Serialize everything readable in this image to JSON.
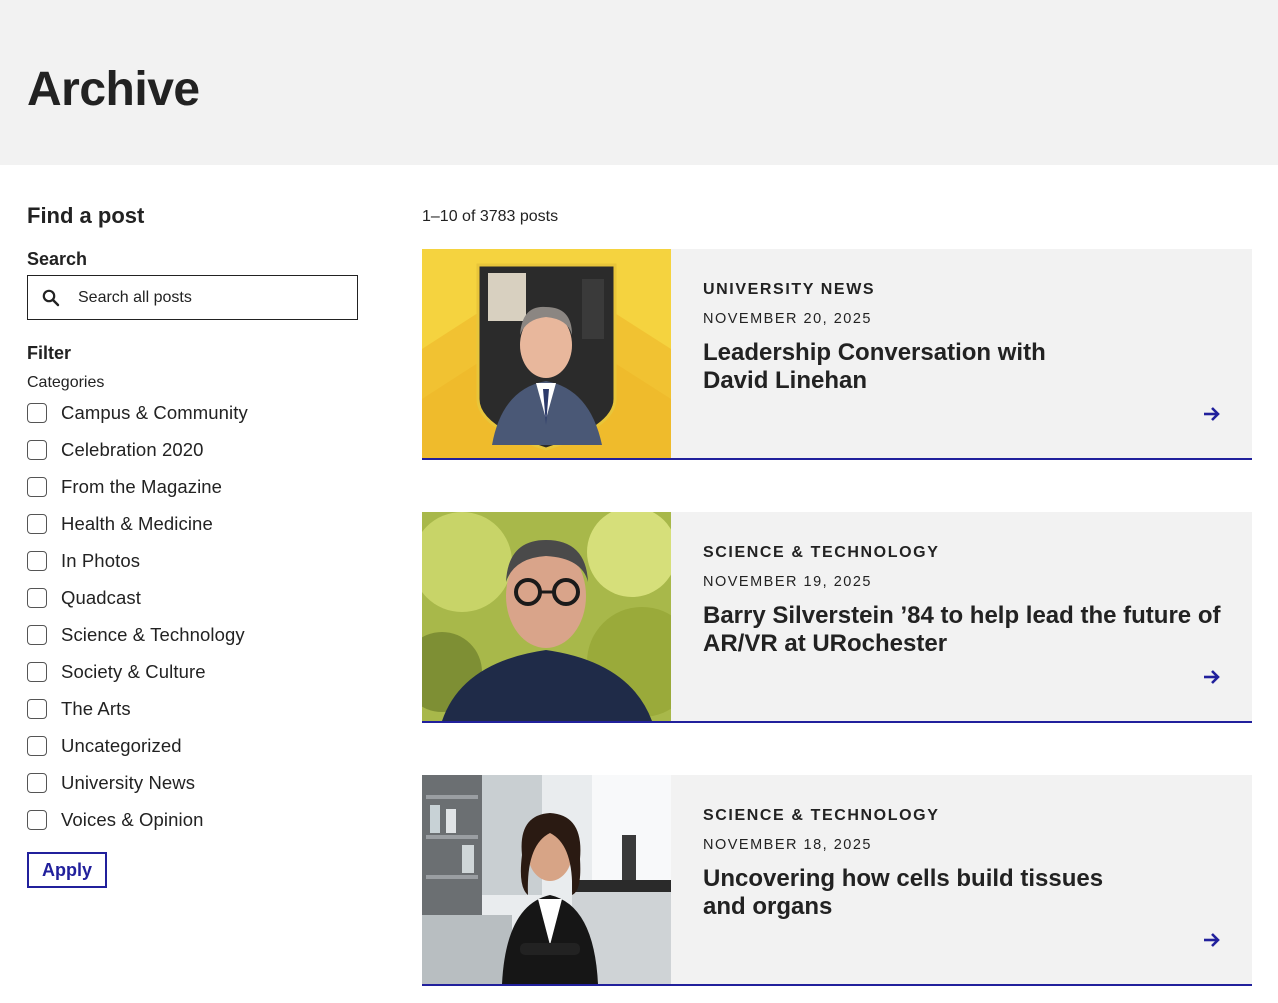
{
  "header": {
    "title": "Archive"
  },
  "sidebar": {
    "find_title": "Find a post",
    "search_label": "Search",
    "search_placeholder": "Search all posts",
    "filter_label": "Filter",
    "categories_label": "Categories",
    "categories": [
      {
        "label": "Campus & Community",
        "checked": false
      },
      {
        "label": "Celebration 2020",
        "checked": false
      },
      {
        "label": "From the Magazine",
        "checked": false
      },
      {
        "label": "Health & Medicine",
        "checked": false
      },
      {
        "label": "In Photos",
        "checked": false
      },
      {
        "label": "Quadcast",
        "checked": false
      },
      {
        "label": "Science & Technology",
        "checked": false
      },
      {
        "label": "Society & Culture",
        "checked": false
      },
      {
        "label": "The Arts",
        "checked": false
      },
      {
        "label": "Uncategorized",
        "checked": false
      },
      {
        "label": "University News",
        "checked": false
      },
      {
        "label": "Voices & Opinion",
        "checked": false
      }
    ],
    "apply_label": "Apply"
  },
  "results": {
    "count_text": "1–10 of 3783 posts"
  },
  "posts": [
    {
      "category": "UNIVERSITY NEWS",
      "date": "NOVEMBER 20, 2025",
      "title": "Leadership Conversation with David Linehan",
      "image_icon": "portrait-shield-yellow",
      "arrow_icon": "arrow-right-icon"
    },
    {
      "category": "SCIENCE & TECHNOLOGY",
      "date": "NOVEMBER 19, 2025",
      "title": "Barry Silverstein ’84 to help lead the future of AR/VR at URochester",
      "image_icon": "portrait-outdoor",
      "arrow_icon": "arrow-right-icon"
    },
    {
      "category": "SCIENCE & TECHNOLOGY",
      "date": "NOVEMBER 18, 2025",
      "title": "Uncovering how cells build tissues and organs",
      "image_icon": "portrait-lab",
      "arrow_icon": "arrow-right-icon"
    }
  ],
  "colors": {
    "accent": "#21209c",
    "header_bg": "#f2f2f2",
    "card_bg": "#f2f2f2",
    "text": "#222222",
    "yellow": "#f5d33f"
  }
}
